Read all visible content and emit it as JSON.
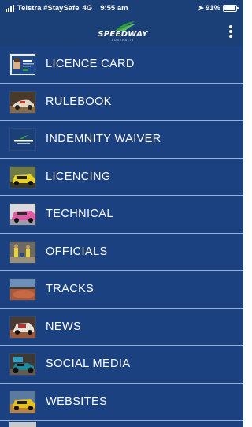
{
  "status_bar": {
    "carrier": "Telstra #StaySafe",
    "network": "4G",
    "time": "9:55 am",
    "battery": "91%",
    "icons": [
      "signal-icon",
      "location-icon",
      "battery-icon"
    ]
  },
  "header": {
    "logo_text": "SPEEDWAY",
    "logo_subtext": "AUSTRALIA",
    "menu_icon": "kebab-menu-icon"
  },
  "colors": {
    "header_bg": "#1b3f77",
    "menu_bg": "#1b4180",
    "divider": "#9ab0cf",
    "text": "#ffffff"
  },
  "menu": {
    "items": [
      {
        "label": "LICENCE CARD",
        "icon": "licence-card-thumbnail"
      },
      {
        "label": "RULEBOOK",
        "icon": "rulebook-thumbnail"
      },
      {
        "label": "INDEMNITY WAIVER",
        "icon": "indemnity-waiver-thumbnail"
      },
      {
        "label": "LICENCING",
        "icon": "licencing-thumbnail"
      },
      {
        "label": "TECHNICAL",
        "icon": "technical-thumbnail"
      },
      {
        "label": "OFFICIALS",
        "icon": "officials-thumbnail"
      },
      {
        "label": "TRACKS",
        "icon": "tracks-thumbnail"
      },
      {
        "label": "NEWS",
        "icon": "news-thumbnail"
      },
      {
        "label": "SOCIAL MEDIA",
        "icon": "social-media-thumbnail"
      },
      {
        "label": "WEBSITES",
        "icon": "websites-thumbnail"
      }
    ]
  }
}
